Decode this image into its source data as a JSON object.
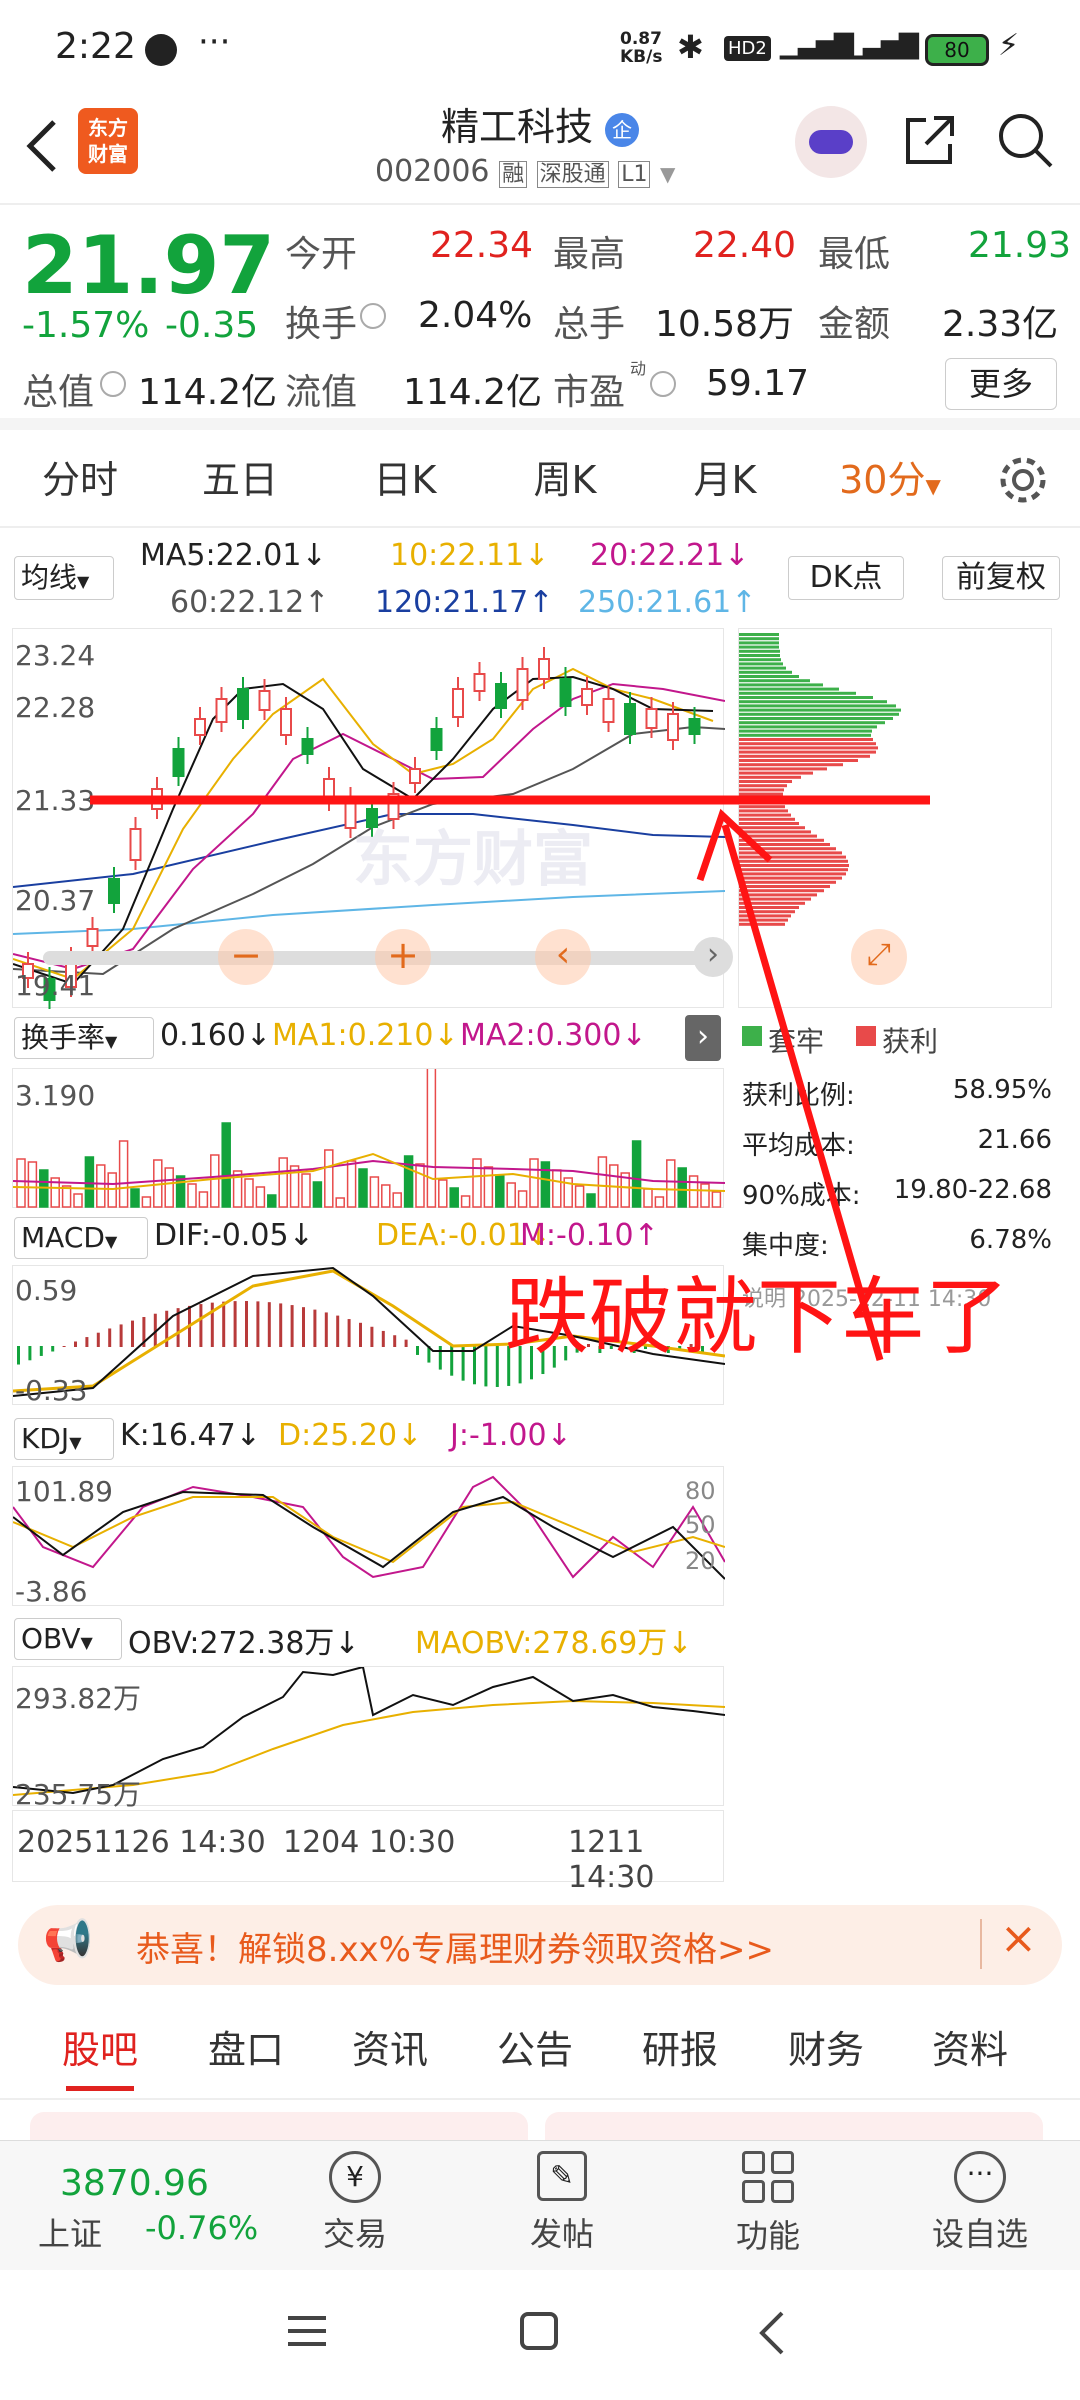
{
  "status": {
    "time": "2:22",
    "net_speed": "0.87\nKB/s",
    "battery": "80"
  },
  "header": {
    "logo": "东方\n财富",
    "title": "精工科技",
    "title_badge": "企",
    "code": "002006",
    "tags": [
      "融",
      "深股通",
      "L1"
    ]
  },
  "quote": {
    "price": "21.97",
    "change_pct": "-1.57%",
    "change": "-0.35",
    "labels": {
      "open": "今开",
      "high": "最高",
      "low": "最低",
      "turnover": "换手",
      "volume": "总手",
      "amount": "金额",
      "mcap": "总值",
      "float": "流值",
      "pe": "市盈",
      "pe_sup": "动",
      "more": "更多"
    },
    "values": {
      "open": "22.34",
      "high": "22.40",
      "low": "21.93",
      "turnover": "2.04%",
      "volume": "10.58万",
      "amount": "2.33亿",
      "mcap": "114.2亿",
      "float": "114.2亿",
      "pe": "59.17"
    }
  },
  "tabs": [
    "分时",
    "五日",
    "日K",
    "周K",
    "月K",
    "30分"
  ],
  "chart": {
    "ma_type": "均线",
    "ma5": "MA5:22.01↓",
    "ma10": "10:22.11↓",
    "ma20": "20:22.21↓",
    "ma60": "60:22.12↑",
    "ma120": "120:21.17↑",
    "ma250": "250:21.61↑",
    "dk": "DK点",
    "fq": "前复权",
    "yticks": [
      "23.24",
      "22.28",
      "21.33",
      "20.37",
      "19.41"
    ],
    "turnover": {
      "label": "换手率",
      "v": "0.160↓",
      "ma1": "MA1:0.210↓",
      "ma2": "MA2:0.300↓",
      "max": "3.190"
    },
    "macd": {
      "label": "MACD",
      "dif": "DIF:-0.05↓",
      "dea": "DEA:-0.01↓",
      "m": "M:-0.10↑",
      "top": "0.59",
      "bot": "-0.33"
    },
    "kdj": {
      "label": "KDJ",
      "k": "K:16.47↓",
      "d": "D:25.20↓",
      "j": "J:-1.00↓",
      "top": "101.89",
      "bot": "-3.86",
      "r80": "80",
      "r50": "50",
      "r20": "20"
    },
    "obv": {
      "label": "OBV",
      "obv": "OBV:272.38万↓",
      "maobv": "MAOBV:278.69万↓",
      "top": "293.82万",
      "bot": "235.75万"
    },
    "xaxis": [
      "20251126 14:30",
      "1204 10:30",
      "1211 14:30"
    ]
  },
  "chip": {
    "legend_trap": "套牢",
    "legend_profit": "获利",
    "rows": [
      [
        "获利比例:",
        "58.95%"
      ],
      [
        "平均成本:",
        "21.66"
      ],
      [
        "90%成本:",
        "19.80-22.68"
      ],
      [
        "集中度:",
        "6.78%"
      ]
    ],
    "date": "说明 2025-12-11 14:30"
  },
  "annotation": "跌破就下车了",
  "banner": "恭喜！解锁8.xx%专属理财券领取资格>>",
  "info_tabs": [
    "股吧",
    "盘口",
    "资讯",
    "公告",
    "研报",
    "财务",
    "资料"
  ],
  "bottom": {
    "index_value": "3870.96",
    "index_name": "上证",
    "index_change": "-0.76%",
    "items": [
      "交易",
      "发帖",
      "功能",
      "设自选"
    ]
  }
}
